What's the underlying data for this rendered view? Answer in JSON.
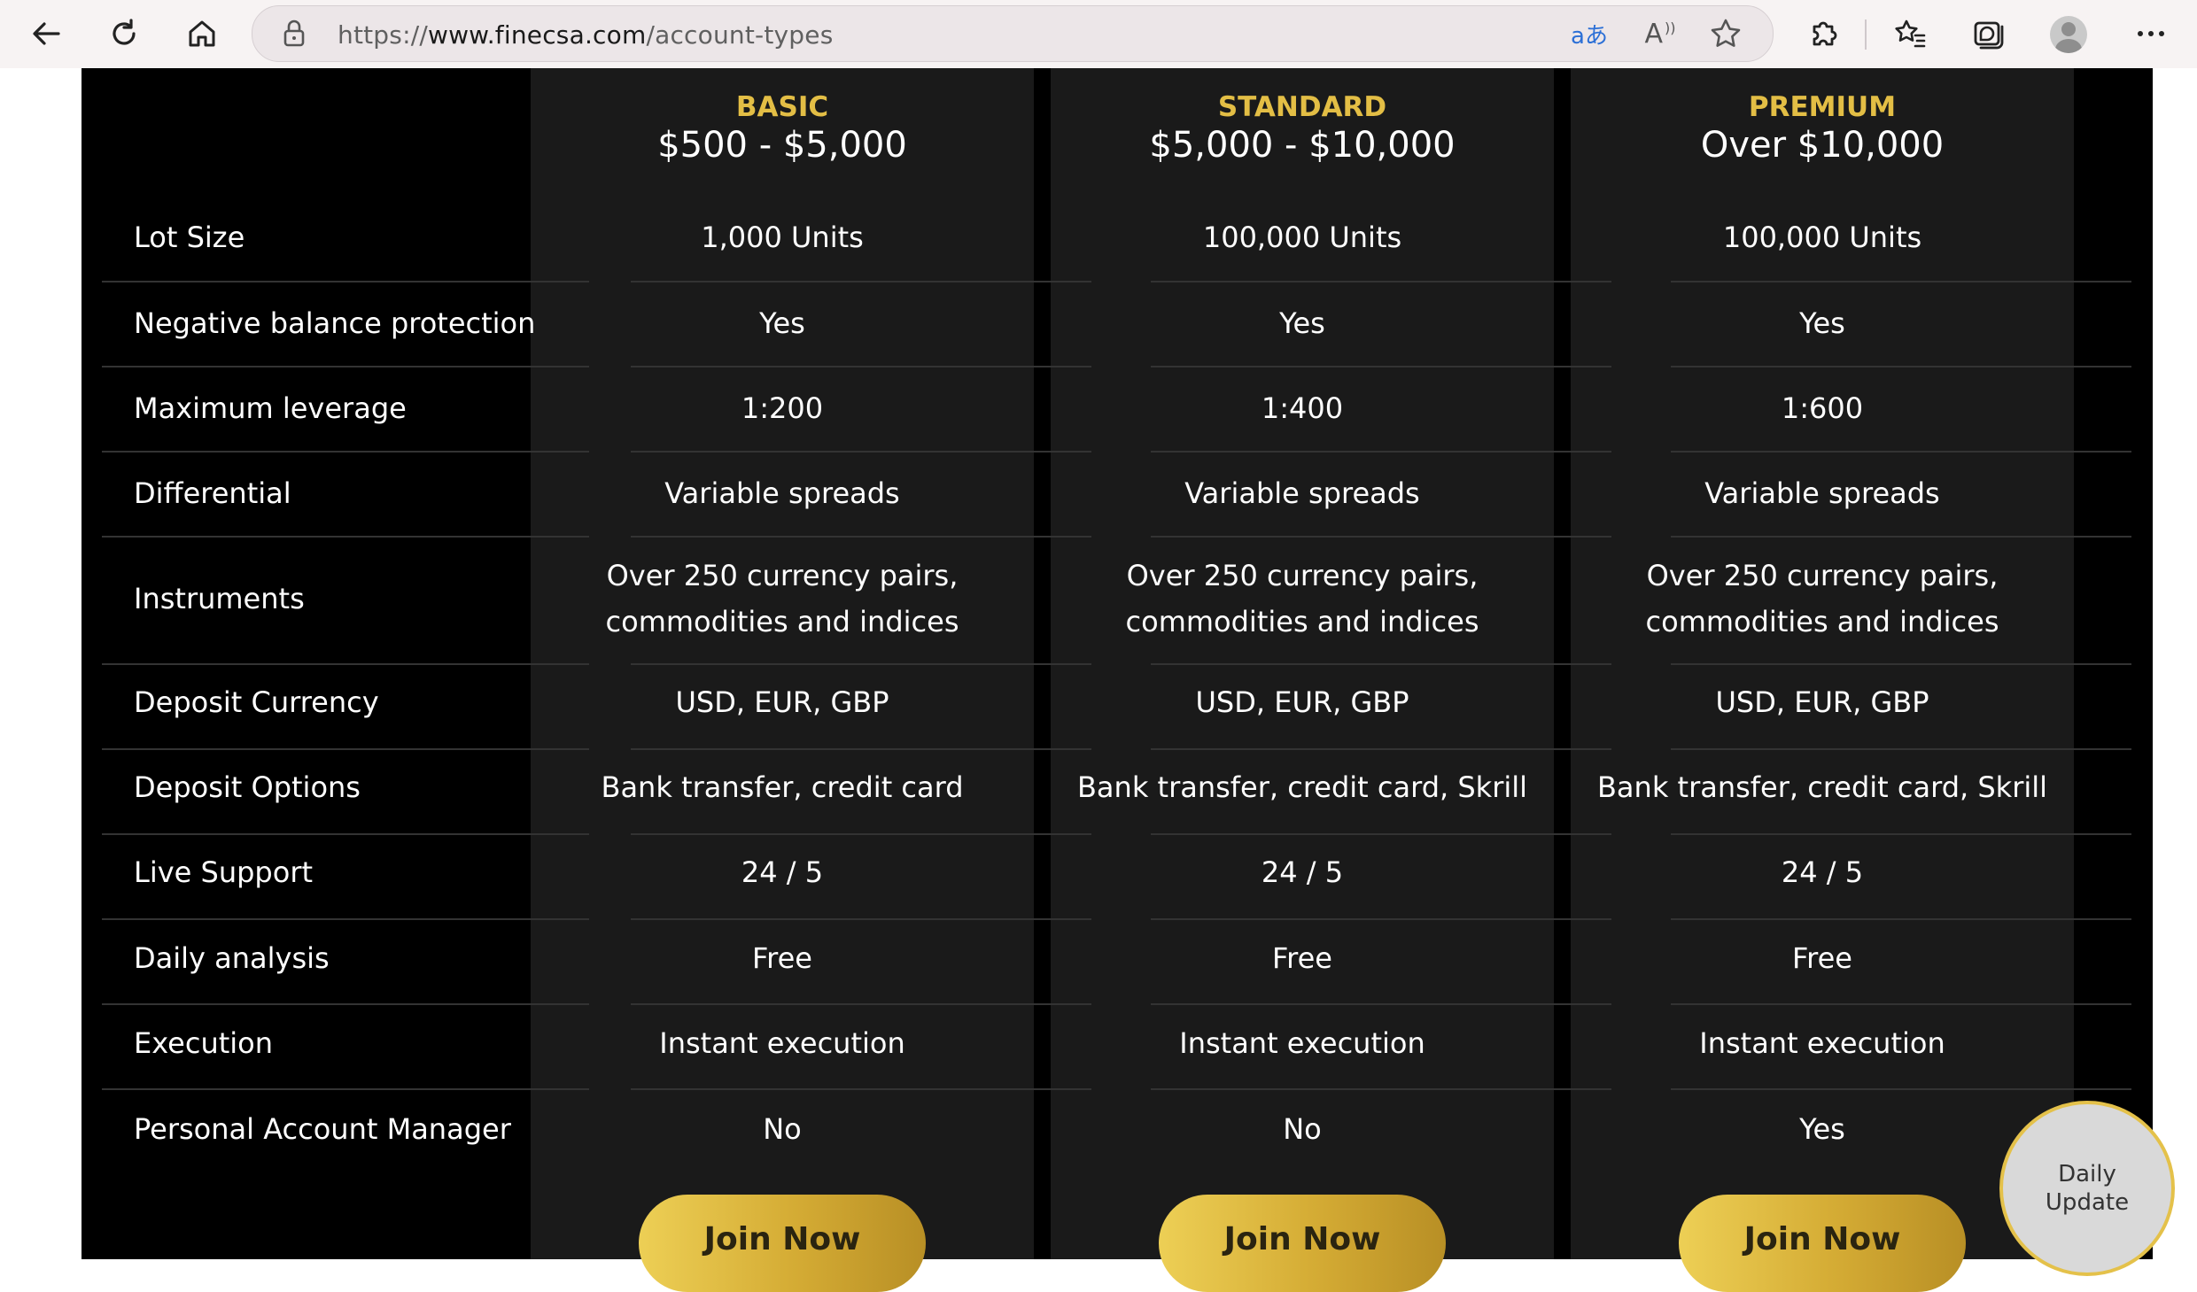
{
  "browser": {
    "url_prefix": "https://",
    "url_host": "www.finecsa.com",
    "url_path": "/account-types",
    "translate_glyph": "aあ",
    "read_aloud_glyph": "A",
    "colors": {
      "bar_bg": "#f7f3f3",
      "address_bg": "#ece6e8"
    }
  },
  "comparison": {
    "colors": {
      "accent": "#e3be45",
      "column_bg": "#1a1a1a",
      "page_bg": "#000000",
      "text": "#ffffff"
    },
    "plans": [
      {
        "name": "BASIC",
        "range": "$500 - $5,000",
        "join_label": "Join Now"
      },
      {
        "name": "STANDARD",
        "range": "$5,000 - $10,000",
        "join_label": "Join Now"
      },
      {
        "name": "PREMIUM",
        "range": "Over $10,000",
        "join_label": "Join Now"
      }
    ],
    "rows": [
      {
        "label": "Lot Size",
        "values": [
          "1,000 Units",
          "100,000 Units",
          "100,000 Units"
        ]
      },
      {
        "label": "Negative balance protection",
        "values": [
          "Yes",
          "Yes",
          "Yes"
        ]
      },
      {
        "label": "Maximum leverage",
        "values": [
          "1:200",
          "1:400",
          "1:600"
        ]
      },
      {
        "label": "Differential",
        "values": [
          "Variable spreads",
          "Variable spreads",
          "Variable spreads"
        ]
      },
      {
        "label": "Instruments",
        "values": [
          "Over 250 currency pairs,\ncommodities and indices",
          "Over 250 currency pairs,\ncommodities and indices",
          "Over 250 currency pairs,\ncommodities and indices"
        ]
      },
      {
        "label": "Deposit Currency",
        "values": [
          "USD, EUR, GBP",
          "USD, EUR, GBP",
          "USD, EUR, GBP"
        ]
      },
      {
        "label": "Deposit Options",
        "values": [
          "Bank transfer, credit card",
          "Bank transfer, credit card, Skrill",
          "Bank transfer, credit card, Skrill"
        ]
      },
      {
        "label": "Live Support",
        "values": [
          "24 / 5",
          "24 / 5",
          "24 / 5"
        ]
      },
      {
        "label": "Daily analysis",
        "values": [
          "Free",
          "Free",
          "Free"
        ]
      },
      {
        "label": "Execution",
        "values": [
          "Instant execution",
          "Instant execution",
          "Instant execution"
        ]
      },
      {
        "label": "Personal Account Manager",
        "values": [
          "No",
          "No",
          "Yes"
        ]
      }
    ]
  },
  "daily_update": {
    "line1": "Daily",
    "line2": "Update"
  }
}
